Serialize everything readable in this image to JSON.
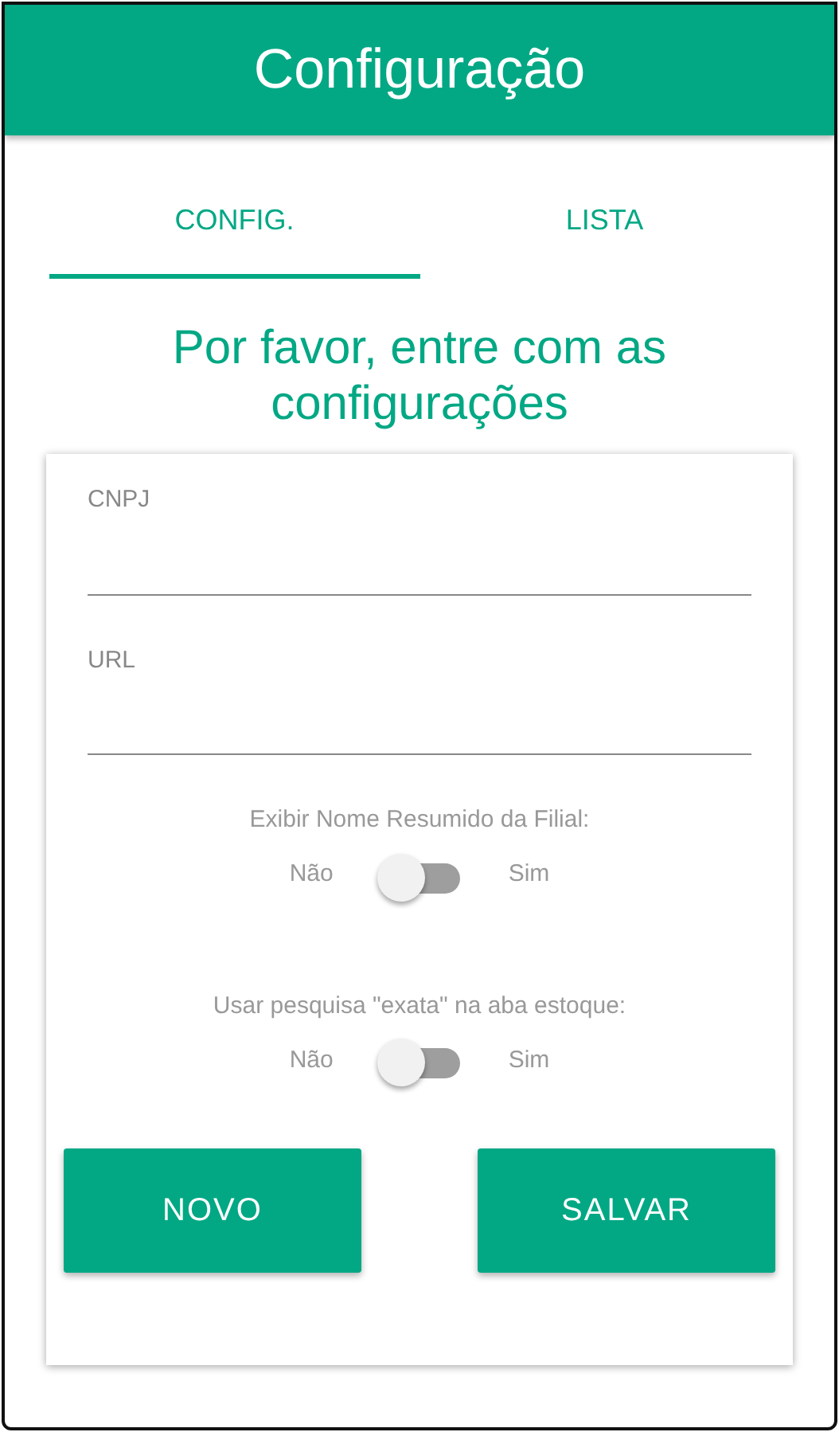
{
  "header": {
    "title": "Configuração"
  },
  "tabs": [
    {
      "label": "CONFIG.",
      "selected": true
    },
    {
      "label": "LISTA",
      "selected": false
    }
  ],
  "heading": "Por favor, entre com as configurações",
  "fields": [
    {
      "label": "CNPJ"
    },
    {
      "label": "URL"
    }
  ],
  "toggles": [
    {
      "label": "Exibir Nome Resumido da Filial:",
      "off_label": "Não",
      "on_label": "Sim",
      "on": false
    },
    {
      "label": "Usar pesquisa \"exata\" na aba estoque:",
      "off_label": "Não",
      "on_label": "Sim",
      "on": false
    }
  ],
  "buttons": [
    "NOVO",
    "SALVAR"
  ]
}
